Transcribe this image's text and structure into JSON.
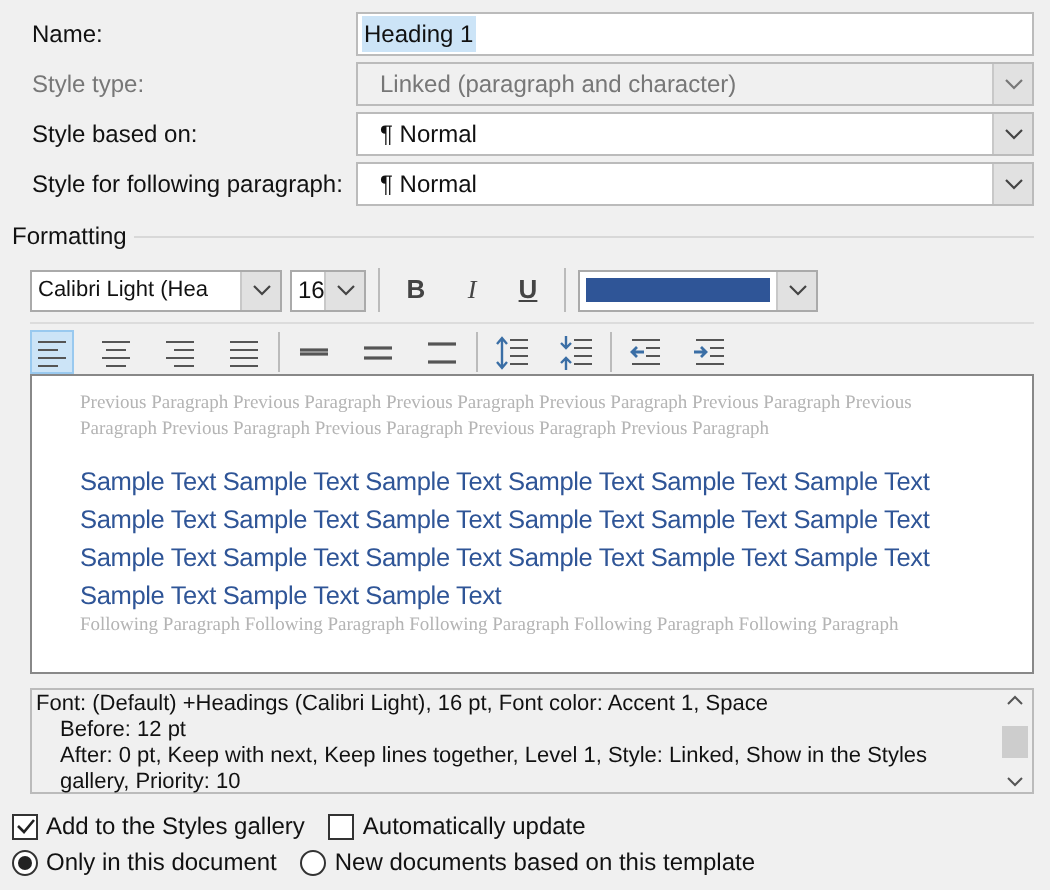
{
  "properties": [
    {
      "label": "Name:",
      "kind": "text",
      "value": "Heading 1",
      "disabled": false
    },
    {
      "label": "Style type:",
      "kind": "dropdown",
      "value": "Linked (paragraph and character)",
      "disabled": true
    },
    {
      "label": "Style based on:",
      "kind": "dropdown",
      "value": "¶ Normal",
      "disabled": false
    },
    {
      "label": "Style for following paragraph:",
      "kind": "dropdown",
      "value": "¶ Normal",
      "disabled": false
    }
  ],
  "formatting": {
    "title": "Formatting",
    "font": "Calibri Light (Hea",
    "size": "16",
    "style_buttons": [
      {
        "label": "B",
        "kind": "bold",
        "selected": false
      },
      {
        "label": "I",
        "kind": "italic",
        "selected": false
      },
      {
        "label": "U",
        "kind": "underline",
        "selected": false
      }
    ],
    "font_color": {
      "color": "#2f5597"
    },
    "paragraph_buttons": [
      {
        "kind": "align-left",
        "selected": true
      },
      {
        "kind": "align-center",
        "selected": false
      },
      {
        "kind": "align-right",
        "selected": false
      },
      {
        "kind": "justify",
        "selected": false
      },
      {
        "kind": "single",
        "selected": false
      },
      {
        "kind": "one-half",
        "selected": false
      },
      {
        "kind": "double",
        "selected": false
      },
      {
        "kind": "space-up",
        "selected": false
      },
      {
        "kind": "space-down",
        "selected": false
      },
      {
        "kind": "outdent",
        "selected": false
      },
      {
        "kind": "indent",
        "selected": false
      }
    ]
  },
  "preview": {
    "previous": "Previous Paragraph Previous Paragraph Previous Paragraph Previous Paragraph Previous Paragraph Previous Paragraph Previous Paragraph Previous Paragraph Previous Paragraph Previous Paragraph",
    "sample": "Sample Text Sample Text Sample Text Sample Text Sample Text Sample Text Sample Text Sample Text Sample Text Sample Text Sample Text Sample Text Sample Text Sample Text Sample Text Sample Text Sample Text Sample Text Sample Text Sample Text Sample Text",
    "following": "Following Paragraph Following Paragraph Following Paragraph Following Paragraph Following Paragraph"
  },
  "description": [
    "Font: (Default) +Headings (Calibri Light), 16 pt, Font color: Accent 1, Space",
    "Before:  12 pt",
    "After:  0 pt, Keep with next, Keep lines together, Level 1, Style: Linked, Show in the Styles gallery, Priority: 10"
  ],
  "options": [
    {
      "label": "Add to the Styles gallery",
      "checked": true
    },
    {
      "label": "Automatically update",
      "checked": false
    }
  ],
  "scope": [
    {
      "label": "Only in this document",
      "selected": true
    },
    {
      "label": "New documents based on this template",
      "selected": false
    }
  ]
}
